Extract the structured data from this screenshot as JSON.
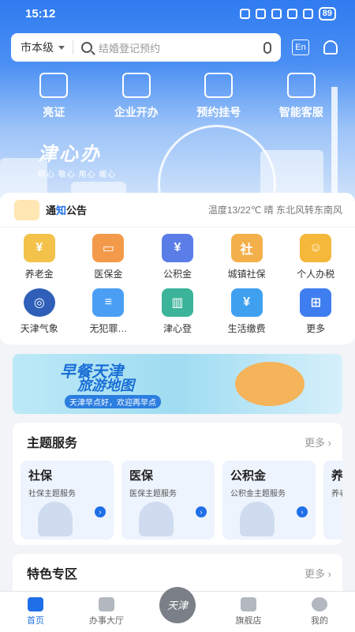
{
  "status_bar": {
    "time": "15:12",
    "battery": "89"
  },
  "search": {
    "region": "市本级",
    "placeholder": "结婚登记预约",
    "lang_button": "En"
  },
  "quick_actions": [
    {
      "label": "亮证",
      "icon": "grid-card-icon"
    },
    {
      "label": "企业开办",
      "icon": "enterprise-icon"
    },
    {
      "label": "预约挂号",
      "icon": "calendar-plus-icon"
    },
    {
      "label": "智能客服",
      "icon": "robot-icon"
    }
  ],
  "brand": {
    "title": "津心办",
    "subtitle": "精心 敬心 用心 暖心"
  },
  "notice": {
    "title_a": "通",
    "title_hl": "知",
    "title_b": "公告",
    "weather": "温度13/22℃ 晴 东北风转东南风"
  },
  "services": [
    {
      "label": "养老金",
      "color": "#f3c24a"
    },
    {
      "label": "医保金",
      "color": "#f39a4a"
    },
    {
      "label": "公积金",
      "color": "#5b7de8"
    },
    {
      "label": "城镇社保",
      "color": "#f3b04a"
    },
    {
      "label": "个人办税",
      "color": "#f5b83a"
    },
    {
      "label": "天津气象",
      "color": "#2f5fb8"
    },
    {
      "label": "无犯罪…",
      "color": "#4a9ef3"
    },
    {
      "label": "津心登",
      "color": "#3cb49a"
    },
    {
      "label": "生活缴费",
      "color": "#3fa0f0"
    },
    {
      "label": "更多",
      "color": "#3f7ef0"
    }
  ],
  "banner": {
    "line1": "早餐天津",
    "line2": "旅游地图",
    "tag": "天津早点好，欢迎再早点"
  },
  "theme_section": {
    "title": "主题服务",
    "more": "更多",
    "cards": [
      {
        "title": "社保",
        "sub": "社保主题服务"
      },
      {
        "title": "医保",
        "sub": "医保主题服务"
      },
      {
        "title": "公积金",
        "sub": "公积金主题服务"
      },
      {
        "title": "养",
        "sub": "养老"
      }
    ]
  },
  "special_section": {
    "title": "特色专区",
    "more": "更多"
  },
  "tabbar": [
    {
      "label": "首页",
      "active": true
    },
    {
      "label": "办事大厅",
      "active": false
    },
    {
      "label": "天津",
      "active": false
    },
    {
      "label": "旗舰店",
      "active": false
    },
    {
      "label": "我的",
      "active": false
    }
  ]
}
